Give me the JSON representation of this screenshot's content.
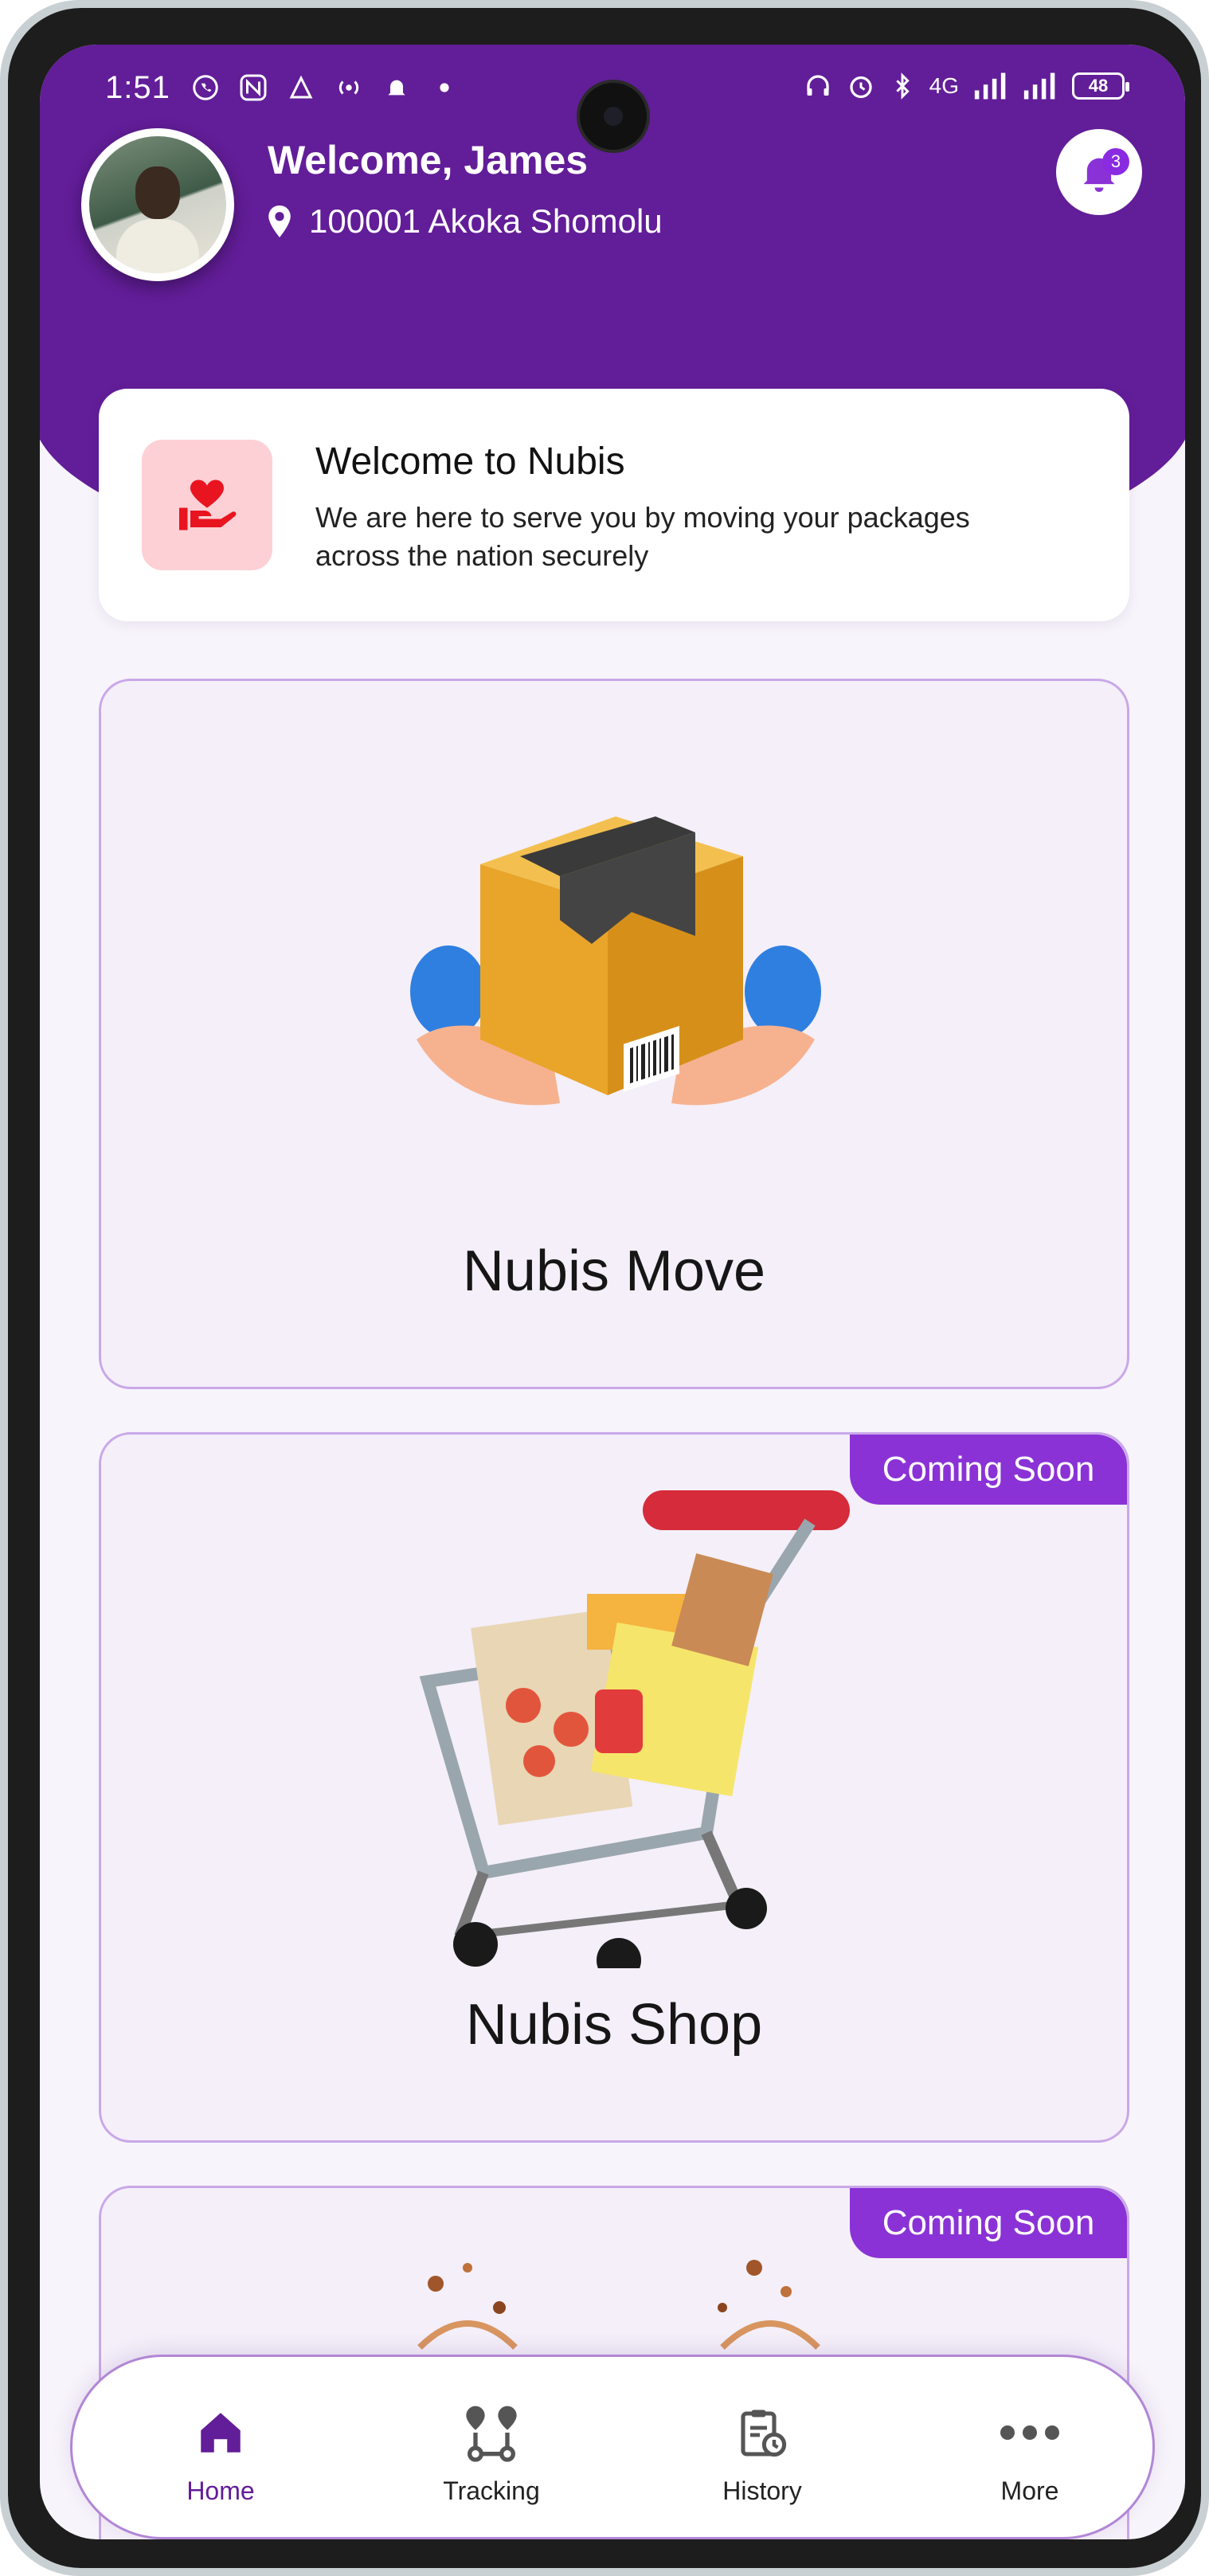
{
  "status_bar": {
    "time": "1:51",
    "network": "4G",
    "battery": "48"
  },
  "header": {
    "welcome_text": "Welcome, James",
    "location": "100001 Akoka Shomolu",
    "notification_count": "3"
  },
  "welcome_card": {
    "title": "Welcome to Nubis",
    "description": "We are here to serve you by moving your packages across the nation securely"
  },
  "services": [
    {
      "title": "Nubis Move",
      "badge": ""
    },
    {
      "title": "Nubis Shop",
      "badge": "Coming Soon"
    },
    {
      "title": "",
      "badge": "Coming Soon"
    }
  ],
  "bottom_nav": {
    "items": [
      {
        "label": "Home",
        "icon": "home-icon",
        "active": true
      },
      {
        "label": "Tracking",
        "icon": "route-icon",
        "active": false
      },
      {
        "label": "History",
        "icon": "history-icon",
        "active": false
      },
      {
        "label": "More",
        "icon": "more-icon",
        "active": false
      }
    ]
  },
  "colors": {
    "primary": "#621d98",
    "accent": "#8a32d6",
    "card_bg": "#f4eff9",
    "card_border": "#c9a8e8"
  }
}
